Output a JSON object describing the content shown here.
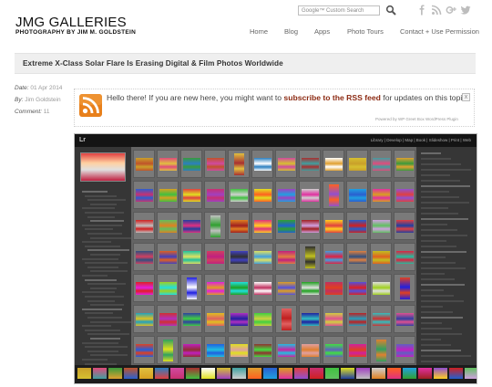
{
  "site": {
    "title": "JMG GALLERIES",
    "tagline": "PHOTOGRAPHY BY JIM M. GOLDSTEIN"
  },
  "search": {
    "placeholder": "Google™ Custom Search",
    "button_icon": "search-icon"
  },
  "social": [
    "facebook-icon",
    "rss-icon",
    "google-plus-icon",
    "twitter-icon"
  ],
  "nav": [
    {
      "label": "Home"
    },
    {
      "label": "Blog"
    },
    {
      "label": "Apps"
    },
    {
      "label": "Photo Tours"
    },
    {
      "label": "Contact + Use Permission"
    }
  ],
  "post": {
    "title": "Extreme X-Class Solar Flare Is Erasing Digital & Film Photos Worldwide",
    "meta": {
      "date_label": "Date:",
      "date_value": "01 Apr 2014",
      "by_label": "By:",
      "by_value": "Jim Goldstein",
      "comment_label": "Comment:",
      "comment_value": "11"
    }
  },
  "rss_box": {
    "text_before": "Hello there! If you are new here, you might want to ",
    "link_text": "subscribe to the RSS feed",
    "text_after": " for updates on this topic.",
    "powered_by": "Powered by WP Greet Box WordPress Plugin",
    "close_label": "x"
  },
  "lightroom": {
    "logo": "Lr",
    "modules": "Library | Develop | Map | Book | Slideshow | Print | Web",
    "accent": "#646464",
    "thumb_colors": [
      [
        "#c9a02a",
        "#e04c7b",
        "#3a9a3c",
        "#c0532a",
        "#e0c040",
        "#2b7fc0",
        "#d04aa0",
        "#a83030",
        "#ffffff",
        "#d6c030",
        "#3fa0a0",
        "#e0a030"
      ],
      [
        "#2a5fd0",
        "#d8a020",
        "#e04040",
        "#c83070",
        "#40c040",
        "#e0e020",
        "#a040c0",
        "#d0d0d0",
        "#ff6020",
        "#20a0e0",
        "#e030a0",
        "#9050d0"
      ],
      [
        "#d02020",
        "#60c060",
        "#2040a0",
        "#c0c0c0",
        "#e08020",
        "#e03080",
        "#30a030",
        "#a02020",
        "#ffd020",
        "#2060d0",
        "#d0a0e0",
        "#e04040"
      ],
      [
        "#305080",
        "#e06020",
        "#20c0a0",
        "#d04060",
        "#4040c0",
        "#e0e060",
        "#c02080",
        "#303030",
        "#40a0e0",
        "#e08040",
        "#c0c020",
        "#e02040"
      ],
      [
        "#e02020",
        "#a0d020",
        "#2020e0",
        "#e020e0",
        "#20e0e0",
        "#ffffff",
        "#e0a020",
        "#20a020",
        "#c03060",
        "#5050e0",
        "#e0e0e0",
        "#e04020"
      ],
      [
        "#20a0c0",
        "#d03030",
        "#3040a0",
        "#e0c020",
        "#b030c0",
        "#40d040",
        "#e06060",
        "#2020a0",
        "#d0d040",
        "#c02020",
        "#30c0c0",
        "#e05090"
      ],
      [
        "#e04020",
        "#30a060",
        "#c020c0",
        "#2060e0",
        "#e0e020",
        "#903030",
        "#20c0e0",
        "#e0a0a0",
        "#40e040",
        "#d020a0",
        "#e08030",
        "#6060c0"
      ]
    ]
  }
}
